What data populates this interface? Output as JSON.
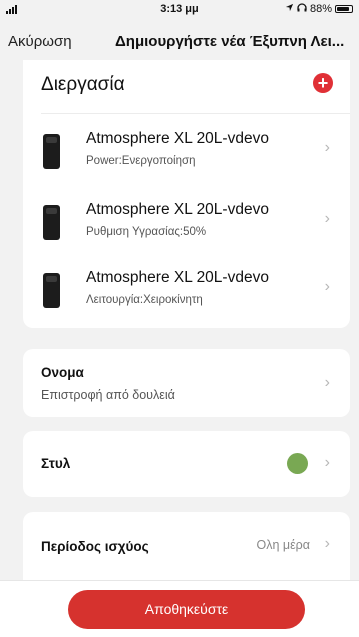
{
  "status": {
    "time": "3:13 μμ",
    "battery": "88%",
    "battery_level": 0.88
  },
  "header": {
    "cancel": "Ακύρωση",
    "title": "Δημιουργήστε νέα Έξυπνη Λει..."
  },
  "process": {
    "title": "Διεργασία",
    "add_icon": "plus",
    "add_color": "#e03036",
    "items": [
      {
        "name": "Atmosphere XL 20L-vdevo",
        "detail": "Power:Ενεργοποίηση"
      },
      {
        "name": "Atmosphere XL 20L-vdevo",
        "detail": "Ρυθμιση Υγρασίας:50%"
      },
      {
        "name": "Atmosphere XL 20L-vdevo",
        "detail": "Λειτουργία:Χειροκίνητη"
      }
    ]
  },
  "name_setting": {
    "label": "Ονομα",
    "value": "Επιστροφή από δουλειά"
  },
  "style_setting": {
    "label": "Στυλ",
    "color": "#79a853"
  },
  "power_setting": {
    "label": "Περίοδος ισχύος",
    "value": "Ολη μέρα"
  },
  "footer": {
    "save": "Αποθηκεύστε",
    "save_color": "#d6322e"
  }
}
